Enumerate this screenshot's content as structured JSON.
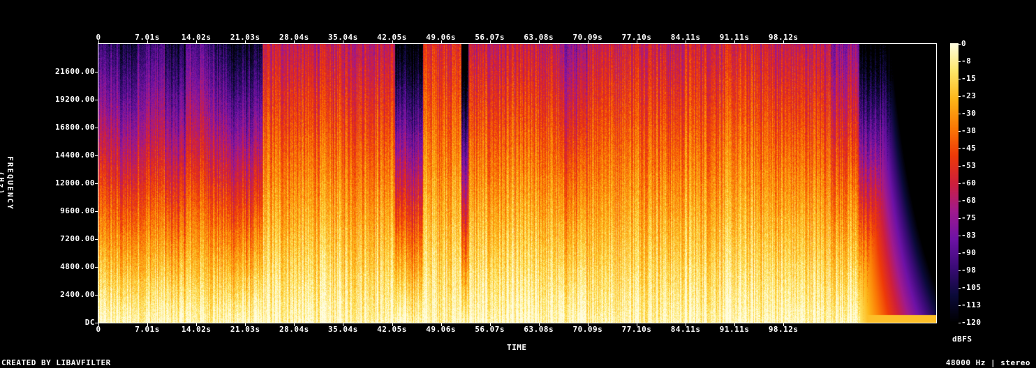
{
  "chart_data": {
    "type": "heatmap",
    "xlabel": "TIME",
    "ylabel": "FREQUENCY (Hz)",
    "x_ticks": [
      "0",
      "7.01s",
      "14.02s",
      "21.03s",
      "28.04s",
      "35.04s",
      "42.05s",
      "49.06s",
      "56.07s",
      "63.08s",
      "70.09s",
      "77.10s",
      "84.11s",
      "91.11s",
      "98.12s"
    ],
    "x_tick_values_s": [
      0,
      7.01,
      14.02,
      21.03,
      28.04,
      35.04,
      42.05,
      49.06,
      56.07,
      63.08,
      70.09,
      77.1,
      84.11,
      91.11,
      98.12
    ],
    "xlim_s": [
      0,
      120
    ],
    "y_ticks": [
      "DC",
      "2400.00",
      "4800.00",
      "7200.00",
      "9600.00",
      "12000.00",
      "14400.00",
      "16800.00",
      "19200.00",
      "21600.00"
    ],
    "y_tick_values_hz": [
      0,
      2400,
      4800,
      7200,
      9600,
      12000,
      14400,
      16800,
      19200,
      21600
    ],
    "ylim_hz": [
      0,
      24000
    ],
    "colorbar": {
      "label": "dBFS",
      "ticks": [
        "0",
        "-8",
        "-15",
        "-23",
        "-30",
        "-38",
        "-45",
        "-53",
        "-60",
        "-68",
        "-75",
        "-83",
        "-90",
        "-98",
        "-105",
        "-113",
        "-120"
      ],
      "range_db": [
        -120,
        0
      ],
      "colormap": [
        "#000000",
        "#0b0a3a",
        "#3b0b78",
        "#6e12a6",
        "#a01a8e",
        "#cf1f3c",
        "#ee3a08",
        "#fb7a05",
        "#fdb518",
        "#fde768",
        "#fffde0"
      ]
    },
    "segments": [
      {
        "t": [
          0.0,
          3.0
        ],
        "level": 0.45
      },
      {
        "t": [
          3.0,
          5.5
        ],
        "level": 0.35
      },
      {
        "t": [
          5.5,
          9.5
        ],
        "level": 0.5
      },
      {
        "t": [
          9.5,
          12.5
        ],
        "level": 0.35
      },
      {
        "t": [
          12.5,
          16.5
        ],
        "level": 0.55
      },
      {
        "t": [
          16.5,
          18.5
        ],
        "level": 0.4
      },
      {
        "t": [
          18.5,
          23.5
        ],
        "level": 0.3
      },
      {
        "t": [
          23.5,
          42.5
        ],
        "level": 0.85
      },
      {
        "t": [
          42.5,
          46.5
        ],
        "level": 0.2
      },
      {
        "t": [
          46.5,
          52.0
        ],
        "level": 0.95
      },
      {
        "t": [
          52.0,
          53.0
        ],
        "level": 0.05
      },
      {
        "t": [
          53.0,
          66.0
        ],
        "level": 0.85
      },
      {
        "t": [
          66.0,
          70.0
        ],
        "level": 0.7
      },
      {
        "t": [
          70.0,
          81.0
        ],
        "level": 0.9
      },
      {
        "t": [
          81.0,
          84.0
        ],
        "level": 0.85
      },
      {
        "t": [
          84.0,
          96.0
        ],
        "level": 0.9
      },
      {
        "t": [
          96.0,
          105.0
        ],
        "level": 0.85
      },
      {
        "t": [
          105.0,
          109.0
        ],
        "level": 0.7
      },
      {
        "t": [
          109.0,
          120.0
        ],
        "level": 0.15
      }
    ]
  },
  "footer": {
    "left": "CREATED BY LIBAVFILTER",
    "right": "48000 Hz | stereo"
  }
}
